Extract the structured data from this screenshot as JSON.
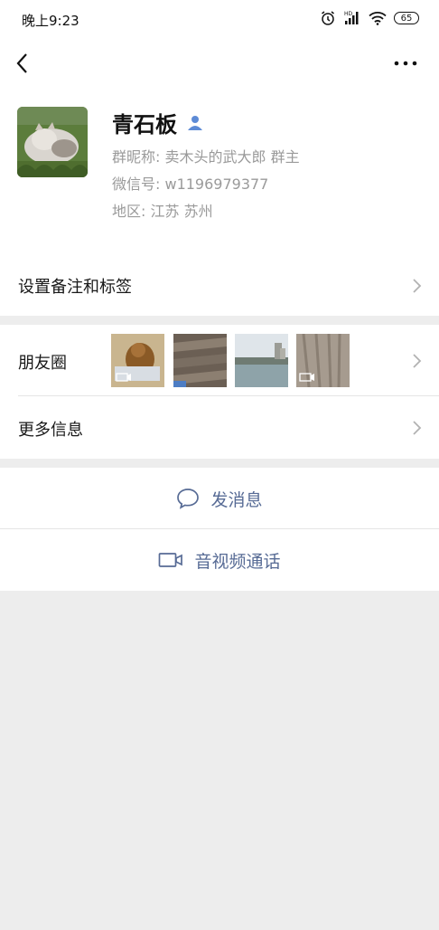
{
  "status_bar": {
    "time": "晚上9:23",
    "battery": "65",
    "icons": [
      "alarm-icon",
      "signal-icon",
      "wifi-icon",
      "battery-icon"
    ]
  },
  "nav": {
    "back_icon": "chevron-left-icon",
    "more_icon": "more-dots-icon"
  },
  "profile": {
    "name": "青石板",
    "group_nickname": "群昵称:  卖木头的武大郎 群主",
    "wechat_id": "微信号:  w1196979377",
    "region": "地区:  江苏  苏州"
  },
  "menu": {
    "remark_label": "设置备注和标签",
    "moments_label": "朋友圈",
    "more_info_label": "更多信息"
  },
  "actions": {
    "message_label": "发消息",
    "call_label": "音视频通话"
  },
  "colors": {
    "accent": "#576b95",
    "background": "#ededed",
    "secondary_text": "#9a9a9a"
  }
}
